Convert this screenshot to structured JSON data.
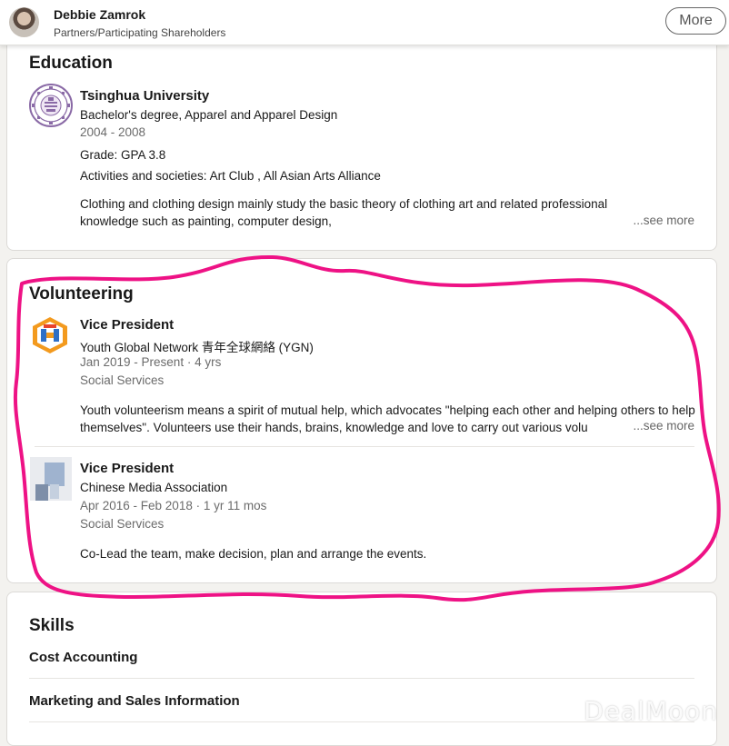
{
  "header": {
    "name": "Debbie Zamrok",
    "subtitle": "Partners/Participating Shareholders",
    "more_label": "More"
  },
  "education": {
    "title": "Education",
    "school": "Tsinghua University",
    "degree": "Bachelor's degree, Apparel and Apparel Design",
    "years": "2004 - 2008",
    "grade": "Grade: GPA 3.8",
    "activities": "Activities and societies: Art Club , All Asian Arts Alliance",
    "description": "Clothing and clothing design mainly study the basic theory of clothing art and related professional knowledge such as painting, computer design,",
    "see_more": "...see more"
  },
  "volunteering": {
    "title": "Volunteering",
    "items": [
      {
        "role": "Vice President",
        "org": "Youth Global Network 青年全球網絡 (YGN)",
        "dates": "Jan 2019 - Present · 4 yrs",
        "cause": "Social Services",
        "description": "Youth volunteerism means a spirit of mutual help, which advocates \"helping each other and helping others to help themselves\". Volunteers use their hands, brains, knowledge and love to carry out various volu",
        "see_more": "...see more"
      },
      {
        "role": "Vice President",
        "org": "Chinese Media Association",
        "dates": "Apr 2016 - Feb 2018 · 1 yr 11 mos",
        "cause": "Social Services",
        "description": "Co-Lead the team, make decision, plan and arrange the events."
      }
    ]
  },
  "skills": {
    "title": "Skills",
    "items": [
      "Cost Accounting",
      "Marketing and Sales Information"
    ]
  },
  "watermark": "DealMoon",
  "colors": {
    "annotation": "#ee1285",
    "background": "#f3f2ef",
    "card": "#ffffff",
    "ygn_orange": "#f39a1e",
    "ygn_blue": "#2f6fc6",
    "tsinghua_purple": "#8a6aa6"
  }
}
